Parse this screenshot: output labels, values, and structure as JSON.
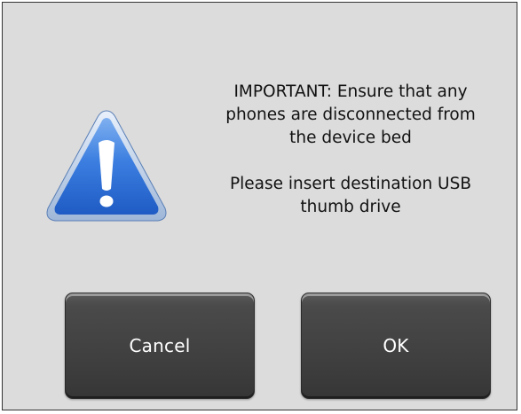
{
  "dialog": {
    "icon": "warning-triangle-icon",
    "message_line_1": "IMPORTANT: Ensure that any",
    "message_line_2": "phones are disconnected from",
    "message_line_3": "the device bed",
    "message_line_4": "Please insert destination USB",
    "message_line_5": "thumb drive"
  },
  "buttons": {
    "cancel_label": "Cancel",
    "ok_label": "OK"
  },
  "colors": {
    "dialog_background": "#dcdcdc",
    "icon_blue": "#2f6fd6",
    "button_background": "#404040",
    "button_text": "#ffffff"
  }
}
